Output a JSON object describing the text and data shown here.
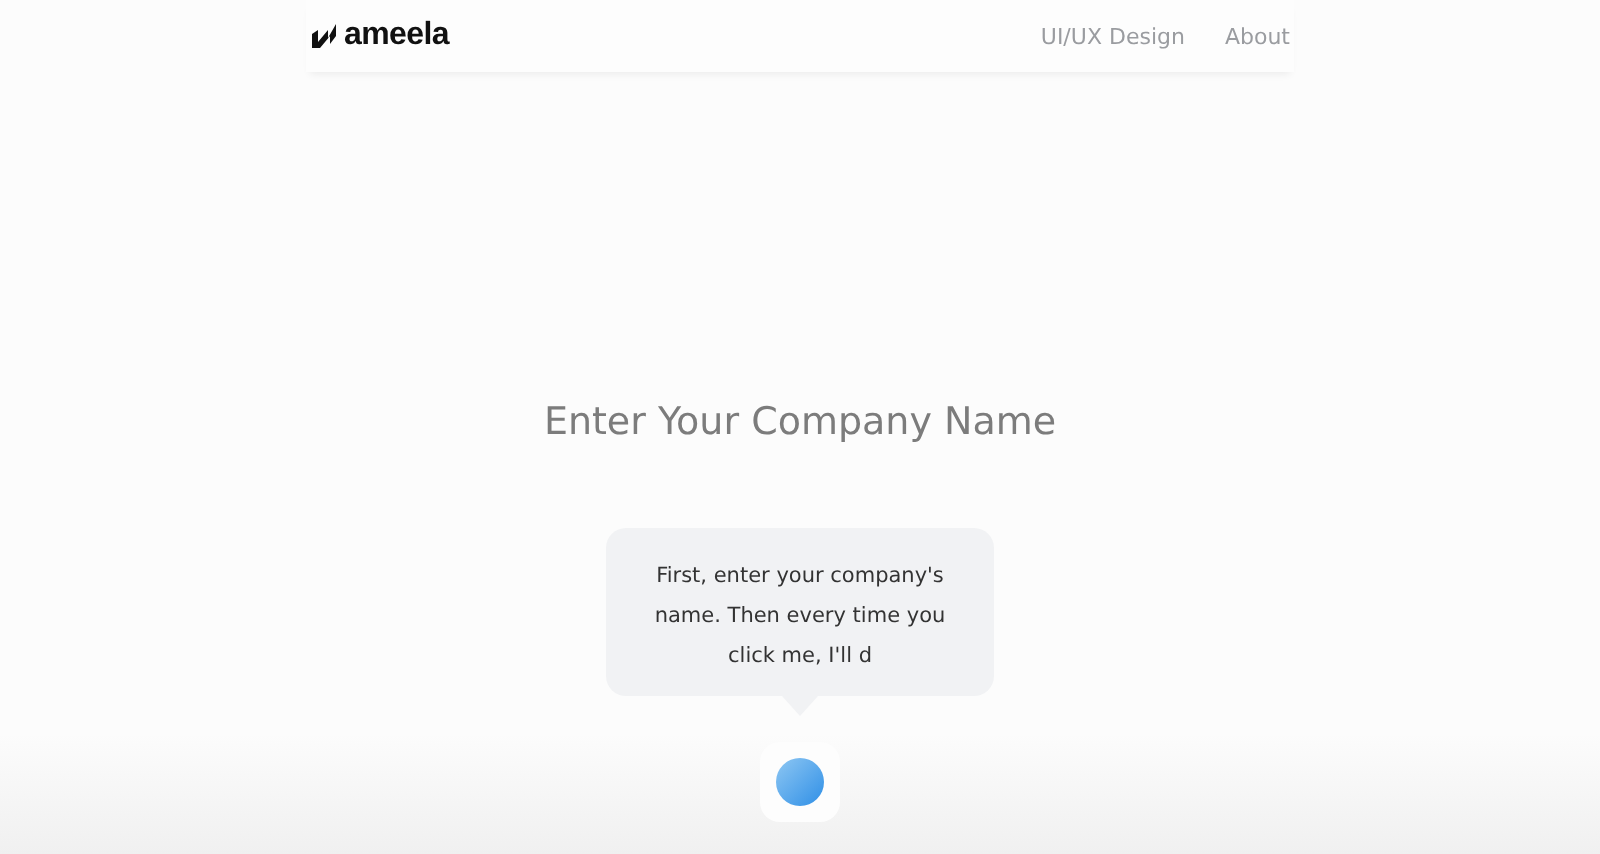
{
  "header": {
    "logo": "ameela",
    "nav": [
      {
        "label": "UI/UX Design"
      },
      {
        "label": "About"
      }
    ]
  },
  "company_field": {
    "placeholder": "Enter Your Company Name"
  },
  "speech_bubble": {
    "text": "First, enter your company's name. Then every time you click me, I'll d"
  }
}
